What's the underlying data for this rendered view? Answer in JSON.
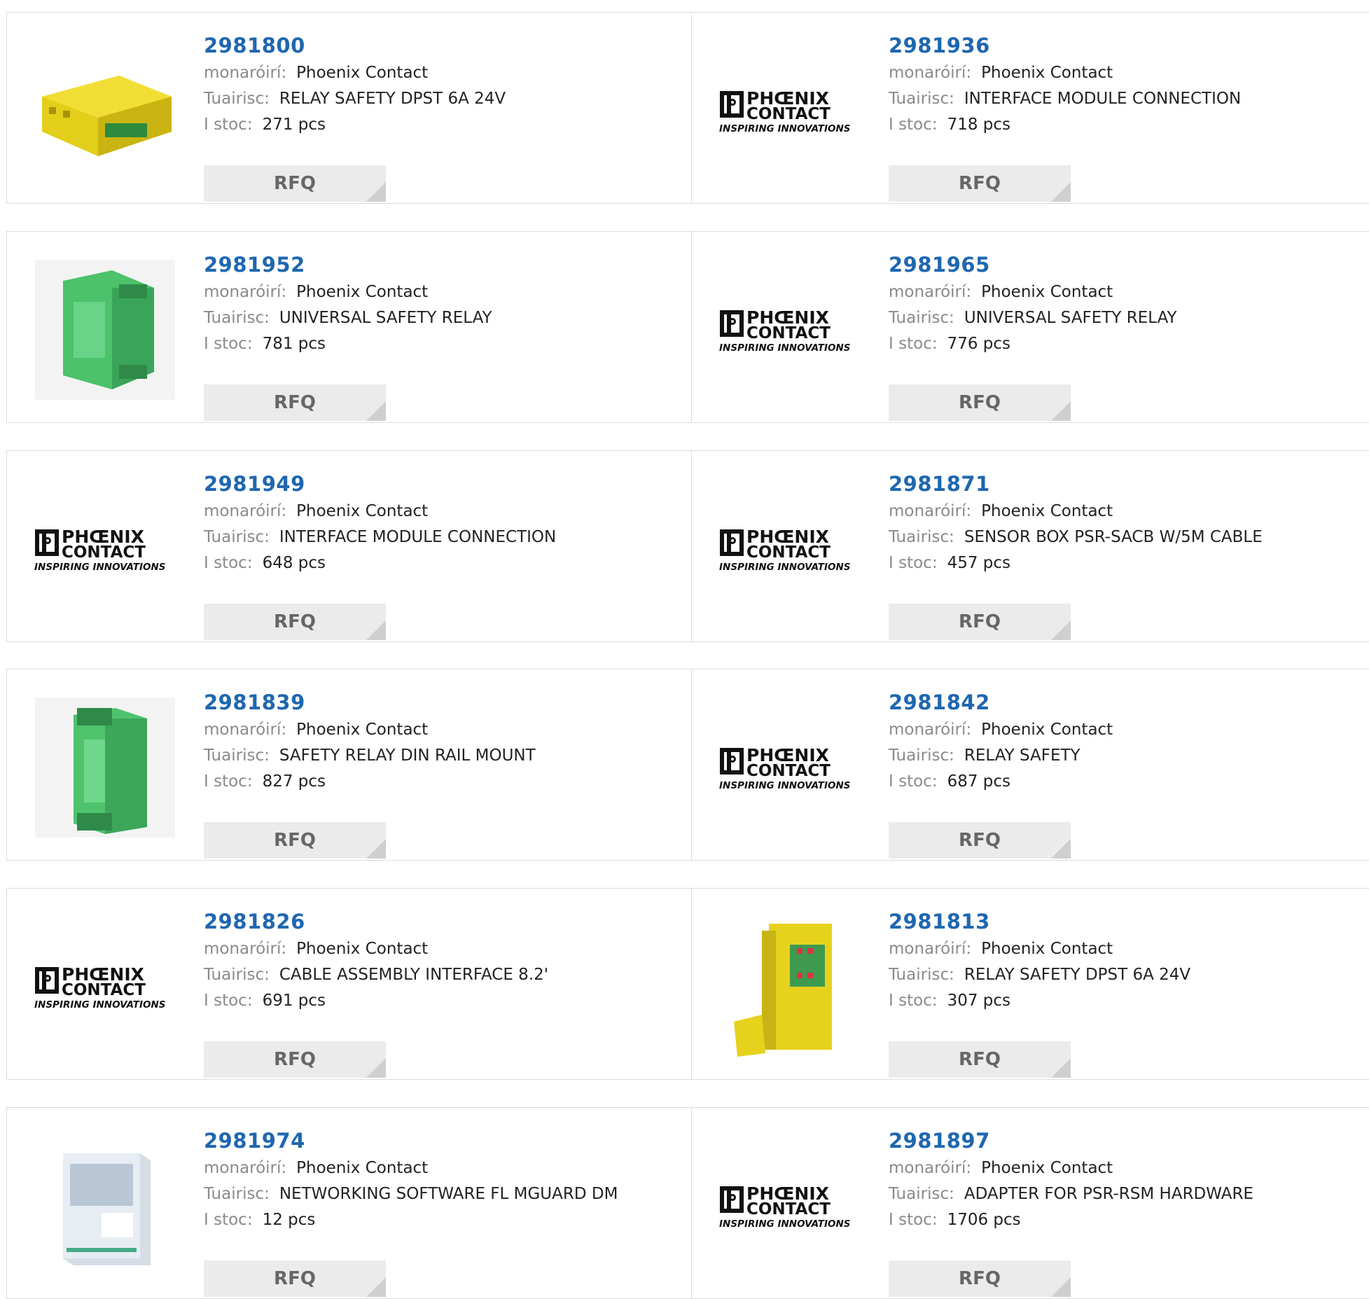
{
  "labels": {
    "manufacturer": "monaróirí:",
    "description": "Tuairisc:",
    "stock": "I stoc:",
    "rfq": "RFQ"
  },
  "logo": {
    "line1": "PHŒNIX",
    "line2": "CONTACT",
    "tagline": "INSPIRING INNOVATIONS"
  },
  "products": [
    {
      "part": "2981800",
      "manufacturer": "Phoenix Contact",
      "description": "RELAY SAFETY DPST 6A 24V",
      "stock": "271 pcs",
      "image": "yellow-relay"
    },
    {
      "part": "2981936",
      "manufacturer": "Phoenix Contact",
      "description": "INTERFACE MODULE CONNECTION",
      "stock": "718 pcs",
      "image": "phoenix-logo"
    },
    {
      "part": "2981952",
      "manufacturer": "Phoenix Contact",
      "description": "UNIVERSAL SAFETY RELAY",
      "stock": "781 pcs",
      "image": "green-relay"
    },
    {
      "part": "2981965",
      "manufacturer": "Phoenix Contact",
      "description": "UNIVERSAL SAFETY RELAY",
      "stock": "776 pcs",
      "image": "phoenix-logo"
    },
    {
      "part": "2981949",
      "manufacturer": "Phoenix Contact",
      "description": "INTERFACE MODULE CONNECTION",
      "stock": "648 pcs",
      "image": "phoenix-logo"
    },
    {
      "part": "2981871",
      "manufacturer": "Phoenix Contact",
      "description": "SENSOR BOX PSR-SACB W/5M CABLE",
      "stock": "457 pcs",
      "image": "phoenix-logo"
    },
    {
      "part": "2981839",
      "manufacturer": "Phoenix Contact",
      "description": "SAFETY RELAY DIN RAIL MOUNT",
      "stock": "827 pcs",
      "image": "green-relay-tall"
    },
    {
      "part": "2981842",
      "manufacturer": "Phoenix Contact",
      "description": "RELAY SAFETY",
      "stock": "687 pcs",
      "image": "phoenix-logo"
    },
    {
      "part": "2981826",
      "manufacturer": "Phoenix Contact",
      "description": "CABLE ASSEMBLY INTERFACE 8.2'",
      "stock": "691 pcs",
      "image": "phoenix-logo"
    },
    {
      "part": "2981813",
      "manufacturer": "Phoenix Contact",
      "description": "RELAY SAFETY DPST 6A 24V",
      "stock": "307 pcs",
      "image": "yellow-relay-tall"
    },
    {
      "part": "2981974",
      "manufacturer": "Phoenix Contact",
      "description": "NETWORKING SOFTWARE FL MGUARD DM",
      "stock": "12 pcs",
      "image": "software-box"
    },
    {
      "part": "2981897",
      "manufacturer": "Phoenix Contact",
      "description": "ADAPTER FOR PSR-RSM HARDWARE",
      "stock": "1706 pcs",
      "image": "phoenix-logo"
    }
  ]
}
